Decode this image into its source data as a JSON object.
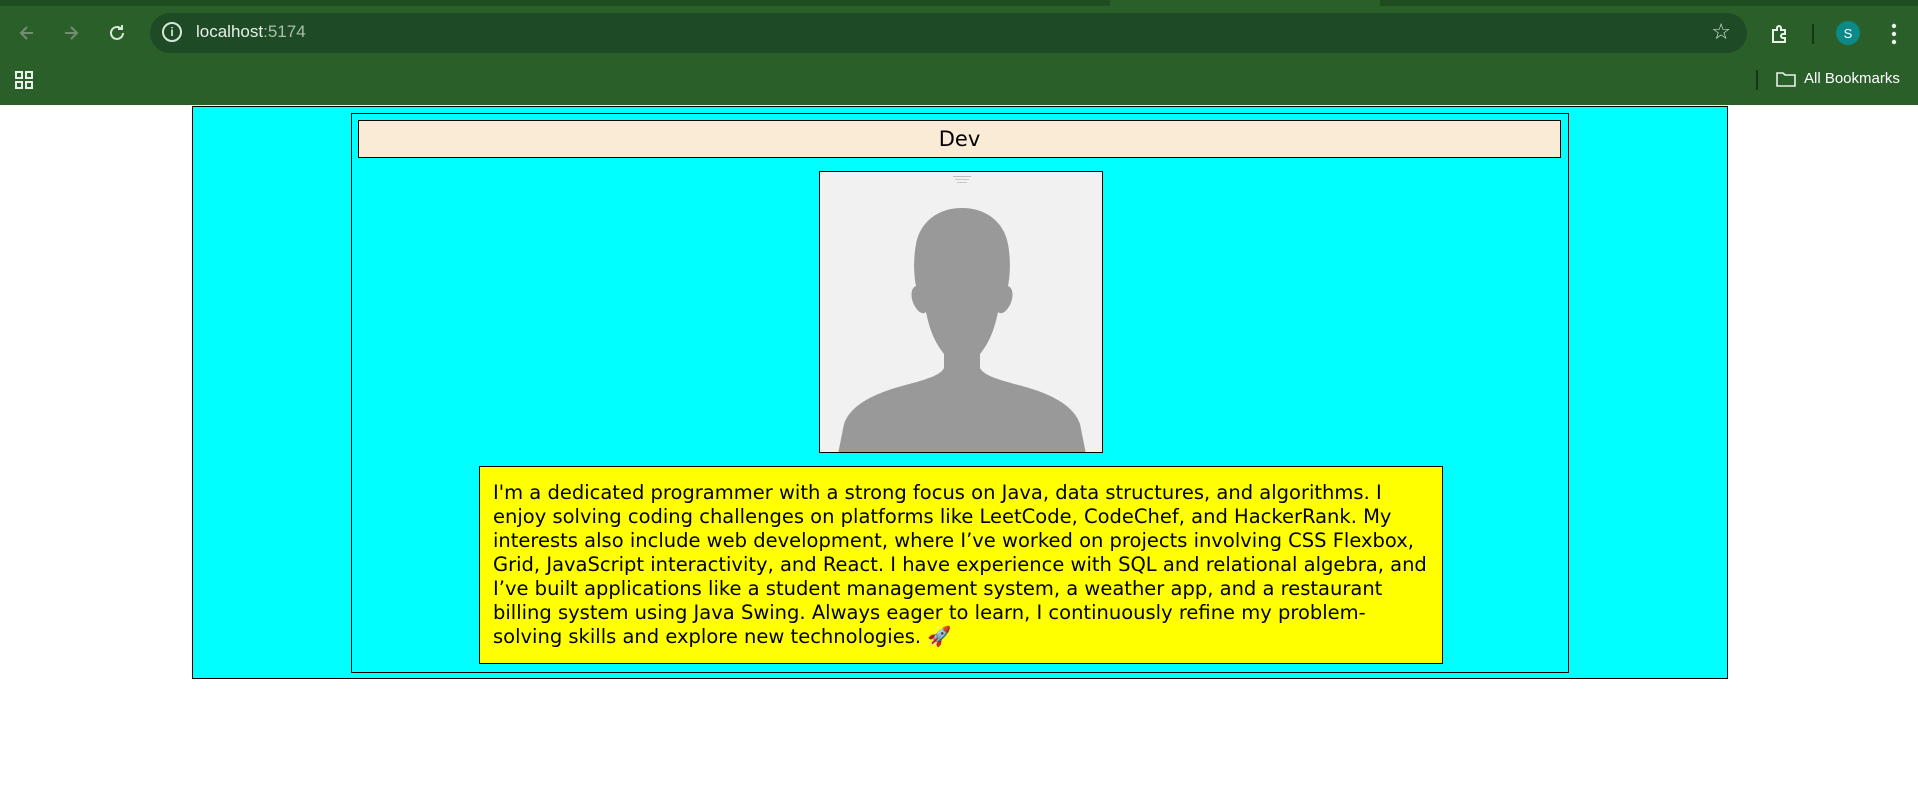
{
  "browser": {
    "url_host": "localhost",
    "url_port": ":5174",
    "profile_initial": "S",
    "bookmarks_label": "All Bookmarks",
    "theme_color": "#2a5f2a"
  },
  "icons": {
    "back": "arrow-left-icon",
    "forward": "arrow-right-icon",
    "reload": "reload-icon",
    "site_info": "info-icon",
    "bookmark_star": "star-icon",
    "extensions": "puzzle-icon",
    "menu": "kebab-icon",
    "apps": "apps-grid-icon",
    "folder": "folder-icon"
  },
  "profile": {
    "name": "Dev",
    "bio": "I'm a dedicated programmer with a strong focus on Java, data structures, and algorithms. I enjoy solving coding challenges on platforms like LeetCode, CodeChef, and HackerRank. My interests also include web development, where I’ve worked on projects involving CSS Flexbox, Grid, JavaScript interactivity, and React. I have experience with SQL and relational algebra, and I’ve built applications like a student management system, a weather app, and a restaurant billing system using Java Swing. Always eager to learn, I continuously refine my problem-solving skills and explore new technologies. 🚀",
    "colors": {
      "page_background": "#00ffff",
      "name_background": "#faebd7",
      "bio_background": "#ffff00"
    }
  }
}
